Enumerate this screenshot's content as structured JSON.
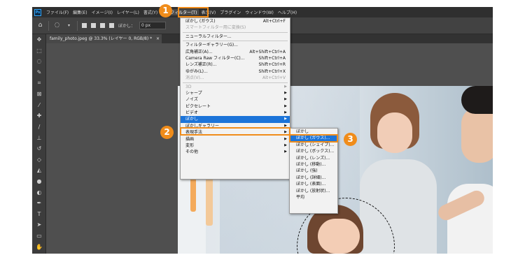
{
  "menubar": {
    "logo": "Ps",
    "items": [
      {
        "label": "ファイル(F)",
        "active": false
      },
      {
        "label": "編集(E)",
        "active": false
      },
      {
        "label": "イメージ(I)",
        "active": false
      },
      {
        "label": "レイヤー(L)",
        "active": false
      },
      {
        "label": "書式(Y)",
        "active": false
      },
      {
        "label": "選",
        "active": false
      },
      {
        "label": "フィルター(T)",
        "active": true
      },
      {
        "label": "表示(V)",
        "active": false
      },
      {
        "label": "プラグイン",
        "active": false
      },
      {
        "label": "ウィンドウ(W)",
        "active": false
      },
      {
        "label": "ヘルプ(H)",
        "active": false
      }
    ]
  },
  "optionsbar": {
    "feather_label": "ぼかし：",
    "feather_value": "0 px"
  },
  "document": {
    "tab_title": "family_photo.jpeg @ 33.3% (レイヤー 0, RGB/8) *",
    "close_glyph": "×"
  },
  "filter_menu": {
    "items": [
      {
        "label": "ぼかし (ガウス)",
        "shortcut": "Alt+Ctrl+F",
        "disabled": false
      },
      {
        "label": "スマートフィルター用に変換(S)",
        "shortcut": "",
        "disabled": true
      },
      {
        "divider": true
      },
      {
        "label": "ニューラルフィルター...",
        "shortcut": "",
        "disabled": false
      },
      {
        "divider": true
      },
      {
        "label": "フィルターギャラリー(G)...",
        "shortcut": "",
        "disabled": false
      },
      {
        "label": "広角補正(A)...",
        "shortcut": "Alt+Shift+Ctrl+A",
        "disabled": false
      },
      {
        "label": "Camera Raw フィルター(C)...",
        "shortcut": "Shift+Ctrl+A",
        "disabled": false
      },
      {
        "label": "レンズ補正(R)...",
        "shortcut": "Shift+Ctrl+R",
        "disabled": false
      },
      {
        "label": "ゆがみ(L)...",
        "shortcut": "Shift+Ctrl+X",
        "disabled": false
      },
      {
        "label": "消点(V)...",
        "shortcut": "Alt+Ctrl+V",
        "disabled": true
      },
      {
        "divider": true
      },
      {
        "label": "3D",
        "submenu": true,
        "disabled": true
      },
      {
        "label": "シャープ",
        "submenu": true,
        "disabled": false
      },
      {
        "label": "ノイズ",
        "submenu": true,
        "disabled": false
      },
      {
        "label": "ピクセレート",
        "submenu": true,
        "disabled": false
      },
      {
        "label": "ビデオ",
        "submenu": true,
        "disabled": false
      },
      {
        "label": "ぼかし",
        "submenu": true,
        "disabled": false,
        "highlighted": true
      },
      {
        "label": "ぼかしギャラリー",
        "submenu": true,
        "disabled": false
      },
      {
        "label": "表現手法",
        "submenu": true,
        "disabled": false
      },
      {
        "label": "描画",
        "submenu": true,
        "disabled": false
      },
      {
        "label": "変形",
        "submenu": true,
        "disabled": false
      },
      {
        "label": "その他",
        "submenu": true,
        "disabled": false
      }
    ]
  },
  "blur_submenu": {
    "items": [
      {
        "label": "ぼかし"
      },
      {
        "label": "ぼかし (ガウス)...",
        "highlighted": true
      },
      {
        "label": "ぼかし (シェイプ)..."
      },
      {
        "label": "ぼかし (ボックス)..."
      },
      {
        "label": "ぼかし (レンズ)..."
      },
      {
        "label": "ぼかし (移動)..."
      },
      {
        "label": "ぼかし (強)"
      },
      {
        "label": "ぼかし (詳細)..."
      },
      {
        "label": "ぼかし (表面)..."
      },
      {
        "label": "ぼかし (放射状)..."
      },
      {
        "label": "平均"
      }
    ]
  },
  "callouts": [
    "1",
    "2",
    "3"
  ],
  "colors": {
    "accent": "#f08c1a",
    "menu_highlight": "#1c74d9",
    "chrome_dark": "#2f2f2f",
    "canvas_bg": "#4f4f4f"
  }
}
